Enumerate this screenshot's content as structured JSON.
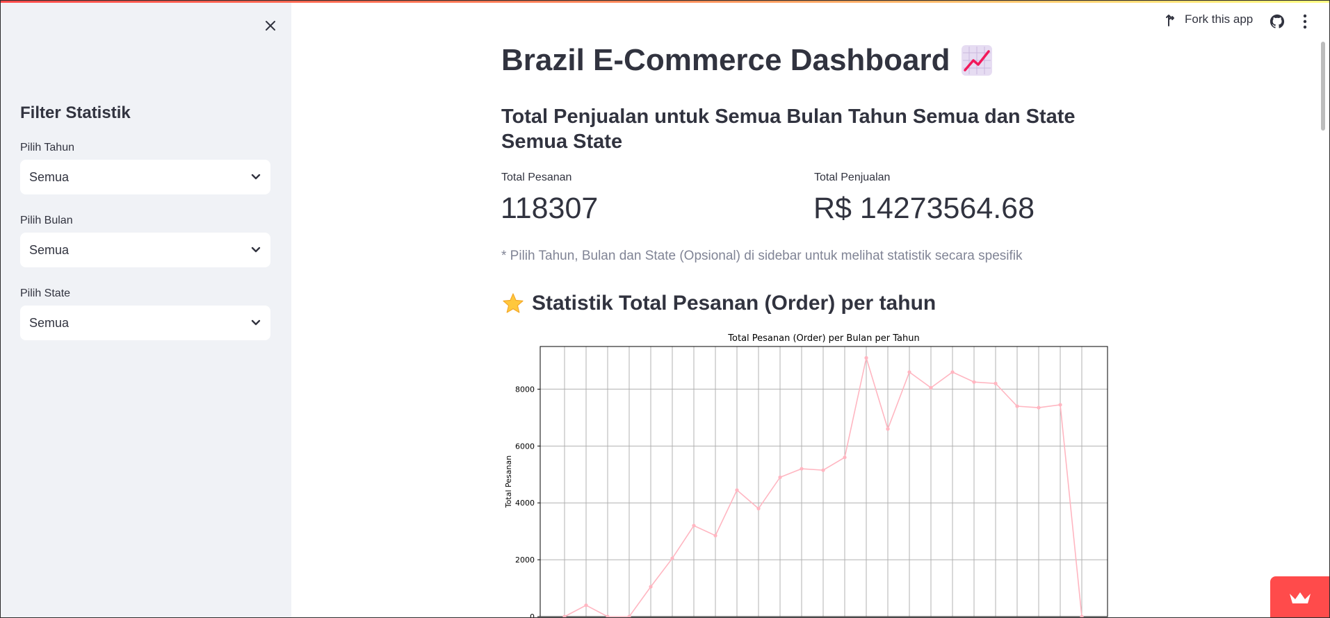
{
  "header": {
    "fork_label": "Fork this app",
    "fork_icon": "fork-icon",
    "github_icon": "github-icon",
    "menu_icon": "kebab-menu-icon"
  },
  "sidebar": {
    "close_icon": "close-icon",
    "title": "Filter Statistik",
    "filters": [
      {
        "label": "Pilih Tahun",
        "value": "Semua"
      },
      {
        "label": "Pilih Bulan",
        "value": "Semua"
      },
      {
        "label": "Pilih State",
        "value": "Semua"
      }
    ]
  },
  "main": {
    "title": "Brazil E-Commerce Dashboard",
    "title_emoji": "chart-increasing-icon",
    "subheader": "Total Penjualan untuk Semua Bulan Tahun Semua dan State Semua State",
    "metrics": [
      {
        "label": "Total Pesanan",
        "value": "118307"
      },
      {
        "label": "Total Penjualan",
        "value": "R$ 14273564.68"
      }
    ],
    "caption": "* Pilih Tahun, Bulan dan State (Opsional) di sidebar untuk melihat statistik secara spesifik",
    "section_title": "Statistik Total Pesanan (Order) per tahun",
    "section_emoji": "star-icon"
  },
  "chart_data": {
    "type": "line",
    "title": "Total Pesanan (Order) per Bulan per Tahun",
    "ylabel": "Total Pesanan",
    "xlabel": "",
    "ylim": [
      0,
      9500
    ],
    "yticks": [
      0,
      2000,
      4000,
      6000,
      8000
    ],
    "grid": true,
    "color": "#ffb6c1",
    "series": [
      {
        "values": [
          0,
          400,
          0,
          0,
          1050,
          2050,
          3200,
          2850,
          4450,
          3800,
          4900,
          5200,
          5150,
          5600,
          9100,
          6600,
          8600,
          8050,
          8600,
          8250,
          8200,
          7400,
          7350,
          7450,
          0
        ]
      }
    ]
  },
  "badge": {
    "icon": "streamlit-crown-icon"
  }
}
